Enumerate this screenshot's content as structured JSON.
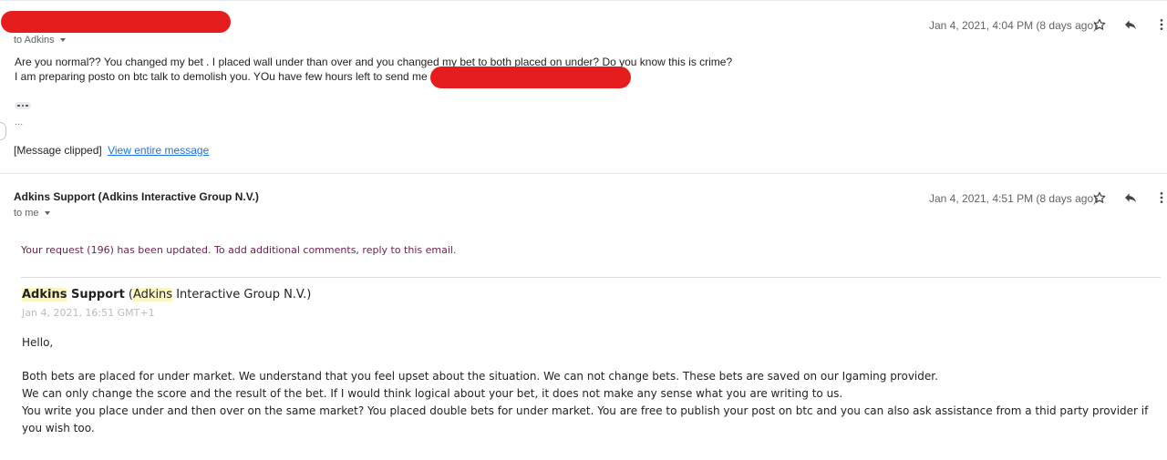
{
  "message1": {
    "recipient_label": "to Adkins",
    "date": "Jan 4, 2021, 4:04 PM (8 days ago)",
    "body_line1": "Are you normal?? You changed my bet . I placed wall under than over and you changed my bet to both placed on under? Do you know this is crime?",
    "body_line2": "I am preparing posto on btc talk to demolish you. YOu have few hours left to send me 0.5 btc",
    "ellipsis": "...",
    "clipped_label": "[Message clipped]",
    "view_entire_label": "View entire message"
  },
  "message2": {
    "sender": "Adkins Support (Adkins Interactive Group N.V.)",
    "recipient_label": "to me",
    "date": "Jan 4, 2021, 4:51 PM (8 days ago)",
    "update_notice": "Your request (196) has been updated. To add additional comments, reply to this email.",
    "inner": {
      "sender_name_highlight": "Adkins",
      "sender_name_rest": " Support",
      "sender_org_open": " (",
      "sender_org_highlight": "Adkins",
      "sender_org_rest": " Interactive Group N.V.)",
      "date": "Jan 4, 2021, 16:51 GMT+1"
    },
    "greeting": "Hello,",
    "paragraph_line1": "Both bets are placed for under market. We understand that you feel upset about the situation. We can not change bets. These bets are saved on our Igaming provider.",
    "paragraph_line2": "We can only change the score and the result of the bet. If I would think logical about your bet, it does not make any sense what you are writing to us.",
    "paragraph_line3": "You write you place under and then over on the same market? You placed double bets for under market. You are free to publish your post on btc and you can also ask assistance from a thid party provider if you wish too."
  },
  "icons": {
    "star": "star-icon",
    "reply": "reply-icon",
    "more": "more-vert-icon"
  },
  "colors": {
    "redaction": "#e51d1f",
    "link": "#1a73e8",
    "highlight": "#fbf5c0",
    "notice_text": "#6b1d4f"
  }
}
